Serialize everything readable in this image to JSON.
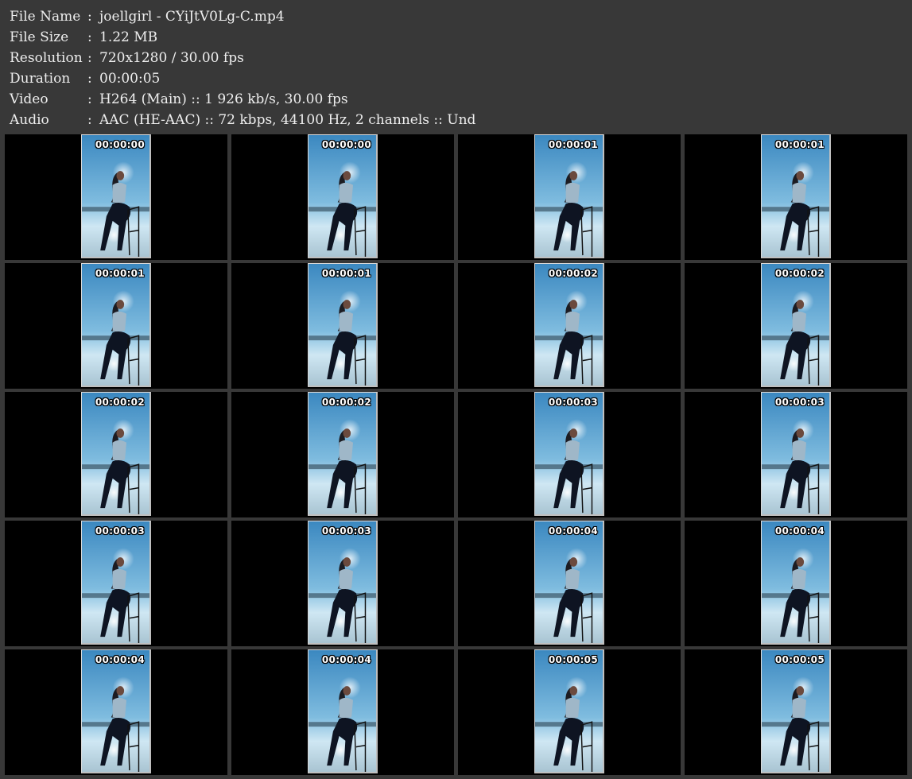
{
  "meta": [
    {
      "label": "File Name",
      "sep": ":",
      "value": "joellgirl - CYiJtV0Lg-C.mp4"
    },
    {
      "label": "File Size",
      "sep": ":",
      "value": "1.22 MB"
    },
    {
      "label": "Resolution",
      "sep": ":",
      "value": "720x1280 / 30.00 fps"
    },
    {
      "label": "Duration",
      "sep": ":",
      "value": "00:00:05"
    },
    {
      "label": "Video",
      "sep": ":",
      "value": "H264 (Main) :: 1 926 kb/s, 30.00 fps"
    },
    {
      "label": "Audio",
      "sep": ":",
      "value": "AAC (HE-AAC) :: 72 kbps, 44100 Hz, 2 channels :: Und"
    }
  ],
  "thumbnails": [
    {
      "timestamp": "00:00:00"
    },
    {
      "timestamp": "00:00:00"
    },
    {
      "timestamp": "00:00:01"
    },
    {
      "timestamp": "00:00:01"
    },
    {
      "timestamp": "00:00:01"
    },
    {
      "timestamp": "00:00:01"
    },
    {
      "timestamp": "00:00:02"
    },
    {
      "timestamp": "00:00:02"
    },
    {
      "timestamp": "00:00:02"
    },
    {
      "timestamp": "00:00:02"
    },
    {
      "timestamp": "00:00:03"
    },
    {
      "timestamp": "00:00:03"
    },
    {
      "timestamp": "00:00:03"
    },
    {
      "timestamp": "00:00:03"
    },
    {
      "timestamp": "00:00:04"
    },
    {
      "timestamp": "00:00:04"
    },
    {
      "timestamp": "00:00:04"
    },
    {
      "timestamp": "00:00:04"
    },
    {
      "timestamp": "00:00:05"
    },
    {
      "timestamp": "00:00:05"
    }
  ],
  "colors": {
    "background": "#383838",
    "cell_background": "#000000",
    "text": "#eeeeee",
    "sky_top": "#3f8fc4",
    "sky_bottom": "#bfe0f0"
  }
}
